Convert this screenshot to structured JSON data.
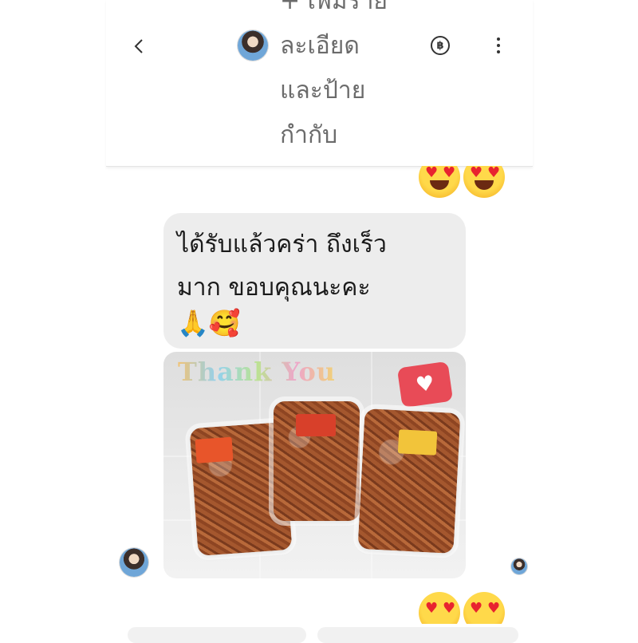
{
  "header": {
    "title": "+ เพิ่มราย\nละเอียด\nและป้าย\nกำกับ",
    "back_icon": "chevron-left-icon",
    "baht_symbol": "฿",
    "menu_icon": "kebab-menu-icon"
  },
  "message": {
    "text": "ได้รับแล้วคร่า  ถึงเร็ว\nมาก  ขอบคุณนะคะ",
    "emoji": "🙏🥰"
  },
  "photo": {
    "caption": "Thank You",
    "badge_icon": "heart-icon"
  },
  "reactions": {
    "emoji": "😍"
  },
  "colors": {
    "bubble": "#ededed",
    "title": "#6b6b6b",
    "badge": "#e84b57"
  }
}
